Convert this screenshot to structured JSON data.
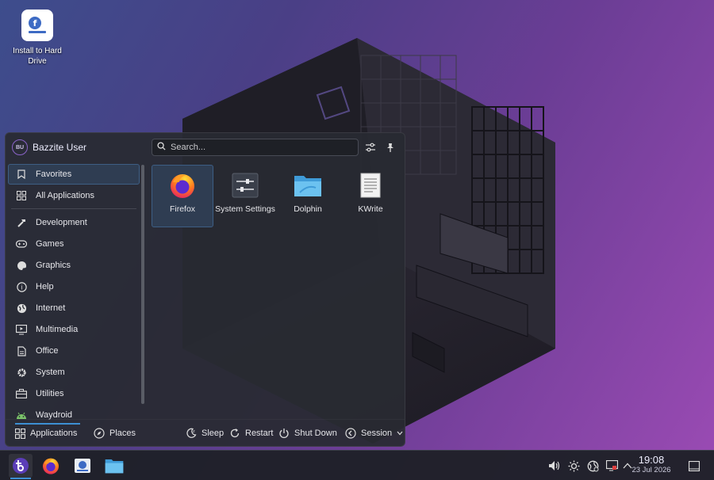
{
  "desktop": {
    "icon_label": "Install to Hard Drive"
  },
  "launcher": {
    "user": {
      "initials": "BU",
      "name": "Bazzite User"
    },
    "search": {
      "placeholder": "Search..."
    },
    "sidebar": {
      "top_items": [
        {
          "label": "Favorites",
          "icon": "bookmark-icon",
          "active": true
        },
        {
          "label": "All Applications",
          "icon": "grid-icon",
          "active": false
        }
      ],
      "categories": [
        {
          "label": "Development",
          "icon": "hammer-icon"
        },
        {
          "label": "Games",
          "icon": "gamepad-icon"
        },
        {
          "label": "Graphics",
          "icon": "palette-icon"
        },
        {
          "label": "Help",
          "icon": "help-icon"
        },
        {
          "label": "Internet",
          "icon": "globe-icon"
        },
        {
          "label": "Multimedia",
          "icon": "monitor-play-icon"
        },
        {
          "label": "Office",
          "icon": "document-icon"
        },
        {
          "label": "System",
          "icon": "gear-icon"
        },
        {
          "label": "Utilities",
          "icon": "toolbox-icon"
        },
        {
          "label": "Waydroid",
          "icon": "android-icon"
        }
      ]
    },
    "favorites": [
      {
        "label": "Firefox",
        "icon": "firefox-icon",
        "selected": true
      },
      {
        "label": "System Settings",
        "icon": "system-settings-icon",
        "selected": false
      },
      {
        "label": "Dolphin",
        "icon": "folder-icon",
        "selected": false
      },
      {
        "label": "KWrite",
        "icon": "text-editor-icon",
        "selected": false
      }
    ],
    "footer": {
      "applications": "Applications",
      "places": "Places",
      "sleep": "Sleep",
      "restart": "Restart",
      "shutdown": "Shut Down",
      "session": "Session"
    }
  },
  "taskbar": {
    "pinned": [
      "app-launcher-icon",
      "firefox-icon",
      "discover-icon",
      "dolphin-icon"
    ],
    "tray": [
      "volume-icon",
      "brightness-icon",
      "network-icon",
      "display-icon",
      "expand-tray-icon"
    ],
    "clock": {
      "time": "19:08",
      "date": "23 Jul 2026"
    }
  },
  "colors": {
    "accent": "#3d8fd3",
    "panel": "#282a32",
    "selection": "#2f3d52"
  }
}
